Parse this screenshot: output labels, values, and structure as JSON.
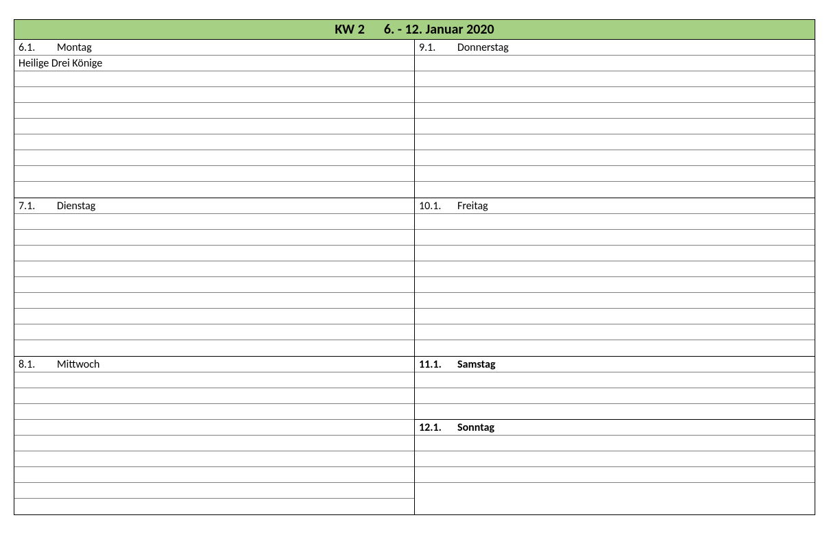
{
  "header": {
    "week": "KW 2",
    "range": "6. - 12. Januar 2020"
  },
  "left": [
    {
      "date": "6.1.",
      "name": "Montag",
      "bold": false,
      "note": "Heilige Drei Könige",
      "rows": 10
    },
    {
      "date": "7.1.",
      "name": "Dienstag",
      "bold": false,
      "note": "",
      "rows": 10
    },
    {
      "date": "8.1.",
      "name": "Mittwoch",
      "bold": false,
      "note": "",
      "rows": 10
    }
  ],
  "right_top": [
    {
      "date": "9.1.",
      "name": "Donnerstag",
      "bold": false,
      "note": "",
      "rows": 10
    },
    {
      "date": "10.1.",
      "name": "Freitag",
      "bold": false,
      "note": "",
      "rows": 10
    }
  ],
  "right_weekend": [
    {
      "date": "11.1.",
      "name": "Samstag",
      "bold": true,
      "rows": 4
    },
    {
      "date": "12.1.",
      "name": "Sonntag",
      "bold": true,
      "rows": 5
    }
  ]
}
